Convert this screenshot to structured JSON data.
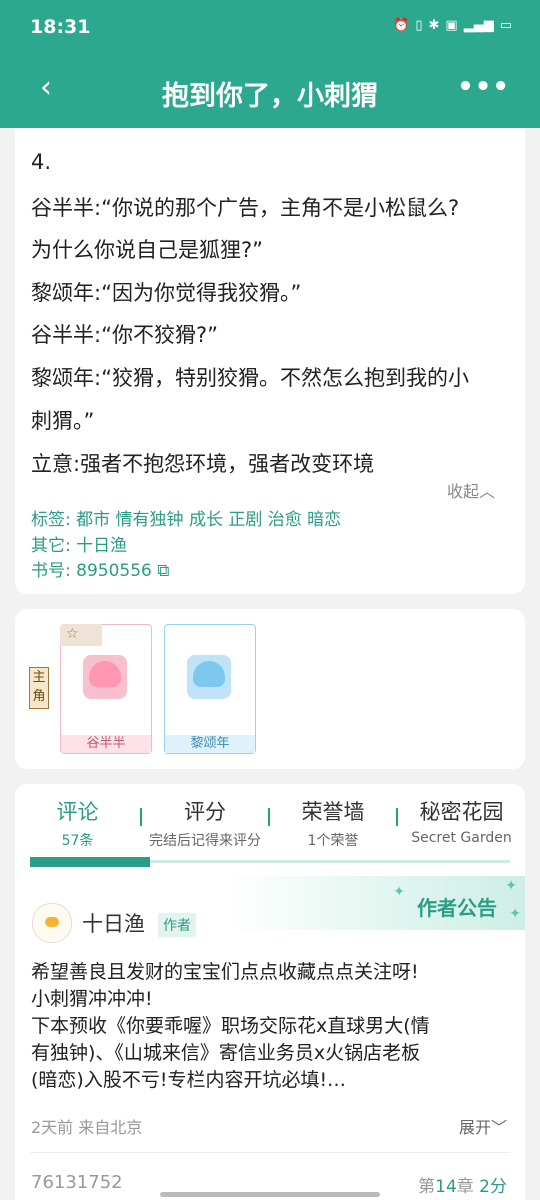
{
  "status_bar": {
    "time": "18:31",
    "icons": [
      "alarm-icon",
      "vibrate-icon",
      "bluetooth-icon",
      "hd-icon",
      "signal-5g-icon",
      "battery-icon"
    ]
  },
  "header": {
    "title": "抱到你了，小刺猬"
  },
  "description": {
    "lines": [
      "4.",
      "谷半半:“你说的那个广告，主角不是小松鼠么?",
      "为什么你说自己是狐狸?”",
      "黎颂年:“因为你觉得我狡猾。”",
      "谷半半:“你不狡猾?”",
      "黎颂年:“狡猾，特别狡猾。不然怎么抱到我的小",
      "刺猬。”",
      "立意:强者不抱怨环境，强者改变环境"
    ],
    "collapse_label": "收起",
    "tags_label": "标签:",
    "tags": [
      "都市",
      "情有独钟",
      "成长",
      "正剧",
      "治愈",
      "暗恋"
    ],
    "other_label": "其它:",
    "other_value": "十日渔",
    "book_label": "书号:",
    "book_id": "8950556"
  },
  "roles": {
    "tag": "主角",
    "items": [
      {
        "name": "谷半半"
      },
      {
        "name": "黎颂年"
      }
    ]
  },
  "tabs": [
    {
      "title": "评论",
      "sub": "57条"
    },
    {
      "title": "评分",
      "sub": "完结后记得来评分"
    },
    {
      "title": "荣誉墙",
      "sub": "1个荣誉"
    },
    {
      "title": "秘密花园",
      "sub": "Secret Garden"
    }
  ],
  "notice": {
    "banner": "作者公告",
    "author": "十日渔",
    "badge": "作者",
    "lines": [
      "希望善良且发财的宝宝们点点收藏点点关注呀!",
      "小刺猬冲冲冲!",
      "下本预收《你要乖喔》职场交际花x直球男大(情",
      "有独钟)、《山城来信》寄信业务员x火锅店老板",
      "(暗恋)入股不亏!专栏内容开坑必填!…"
    ],
    "time": "2天前 来自北京",
    "expand_label": "展开"
  },
  "next_comment": {
    "user_id": "76131752",
    "chapter_prefix": "第",
    "chapter_num": "14",
    "chapter_suffix": "章",
    "score": "2分"
  }
}
